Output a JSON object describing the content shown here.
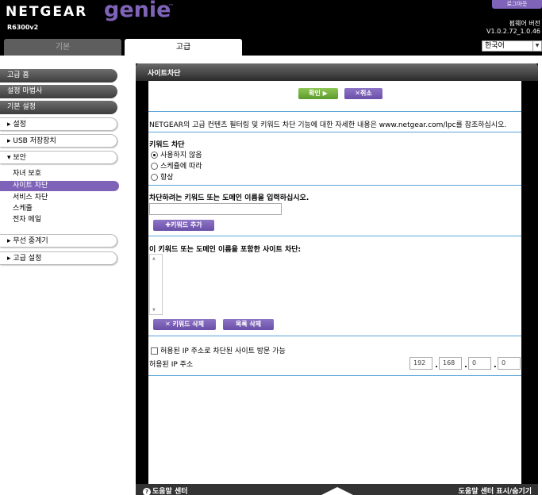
{
  "header": {
    "brand": "NETGEAR",
    "product": "genie",
    "trademark": "™",
    "model": "R6300v2",
    "logout_label": "로그아웃",
    "firmware_label": "펌웨어 버전",
    "firmware_version": "V1.0.2.72_1.0.46",
    "language": "한국어"
  },
  "tabs": {
    "basic": "기본",
    "advanced": "고급"
  },
  "sidebar": {
    "advanced_home": "고급 홈",
    "setup_wizard": "설정 마법사",
    "basic_setup": "기본 설정",
    "setup": "▸ 설정",
    "usb_storage": "▸ USB 저장장치",
    "security": "▾ 보안",
    "security_items": [
      "자녀 보호",
      "사이트 차단",
      "서비스 차단",
      "스케쥴",
      "전자 메일"
    ],
    "wireless_repeater": "▸ 무선 중계기",
    "advanced_setup": "▸ 고급 설정"
  },
  "main": {
    "title": "사이트차단",
    "apply_label": "확인 ▶",
    "cancel_label": "✕취소",
    "info_text": "NETGEAR의 고급 컨텐츠 필터링 및 키워드 차단 기능에 대한 자세한 내용은 www.netgear.com/lpc를 참조하십시오.",
    "keyword_blocking_label": "키워드 차단",
    "radio_options": [
      "사용하지 않음",
      "스케쥴에 따라",
      "항상"
    ],
    "radio_selected": 0,
    "enter_keyword_label": "차단하려는 키워드 또는 도메인 이름을 입력하십시오.",
    "add_keyword_label": "✚키워드 추가",
    "block_sites_label": "이 키워드 또는 도메인 이름을 포함한 사이트 차단:",
    "delete_keyword_label": "✕ 키워드 삭제",
    "clear_list_label": "목록 삭제",
    "allow_trusted_label": "허용된 IP 주소로 차단된 사이트 방문 가능",
    "trusted_ip_label": "허용된 IP 주소",
    "trusted_ip": [
      "192",
      "168",
      "0",
      "0"
    ]
  },
  "footer": {
    "help_center": "도움말 센터",
    "help_toggle": "도움말 센터 표시/숨기기"
  }
}
